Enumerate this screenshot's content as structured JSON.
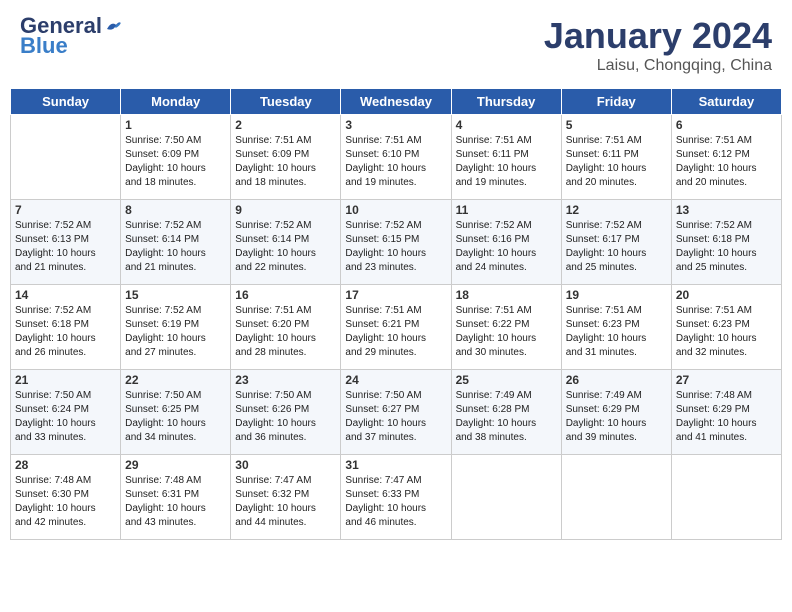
{
  "header": {
    "logo_general": "General",
    "logo_blue": "Blue",
    "month": "January 2024",
    "location": "Laisu, Chongqing, China"
  },
  "weekdays": [
    "Sunday",
    "Monday",
    "Tuesday",
    "Wednesday",
    "Thursday",
    "Friday",
    "Saturday"
  ],
  "weeks": [
    [
      {
        "day": "",
        "info": ""
      },
      {
        "day": "1",
        "info": "Sunrise: 7:50 AM\nSunset: 6:09 PM\nDaylight: 10 hours\nand 18 minutes."
      },
      {
        "day": "2",
        "info": "Sunrise: 7:51 AM\nSunset: 6:09 PM\nDaylight: 10 hours\nand 18 minutes."
      },
      {
        "day": "3",
        "info": "Sunrise: 7:51 AM\nSunset: 6:10 PM\nDaylight: 10 hours\nand 19 minutes."
      },
      {
        "day": "4",
        "info": "Sunrise: 7:51 AM\nSunset: 6:11 PM\nDaylight: 10 hours\nand 19 minutes."
      },
      {
        "day": "5",
        "info": "Sunrise: 7:51 AM\nSunset: 6:11 PM\nDaylight: 10 hours\nand 20 minutes."
      },
      {
        "day": "6",
        "info": "Sunrise: 7:51 AM\nSunset: 6:12 PM\nDaylight: 10 hours\nand 20 minutes."
      }
    ],
    [
      {
        "day": "7",
        "info": "Sunrise: 7:52 AM\nSunset: 6:13 PM\nDaylight: 10 hours\nand 21 minutes."
      },
      {
        "day": "8",
        "info": "Sunrise: 7:52 AM\nSunset: 6:14 PM\nDaylight: 10 hours\nand 21 minutes."
      },
      {
        "day": "9",
        "info": "Sunrise: 7:52 AM\nSunset: 6:14 PM\nDaylight: 10 hours\nand 22 minutes."
      },
      {
        "day": "10",
        "info": "Sunrise: 7:52 AM\nSunset: 6:15 PM\nDaylight: 10 hours\nand 23 minutes."
      },
      {
        "day": "11",
        "info": "Sunrise: 7:52 AM\nSunset: 6:16 PM\nDaylight: 10 hours\nand 24 minutes."
      },
      {
        "day": "12",
        "info": "Sunrise: 7:52 AM\nSunset: 6:17 PM\nDaylight: 10 hours\nand 25 minutes."
      },
      {
        "day": "13",
        "info": "Sunrise: 7:52 AM\nSunset: 6:18 PM\nDaylight: 10 hours\nand 25 minutes."
      }
    ],
    [
      {
        "day": "14",
        "info": "Sunrise: 7:52 AM\nSunset: 6:18 PM\nDaylight: 10 hours\nand 26 minutes."
      },
      {
        "day": "15",
        "info": "Sunrise: 7:52 AM\nSunset: 6:19 PM\nDaylight: 10 hours\nand 27 minutes."
      },
      {
        "day": "16",
        "info": "Sunrise: 7:51 AM\nSunset: 6:20 PM\nDaylight: 10 hours\nand 28 minutes."
      },
      {
        "day": "17",
        "info": "Sunrise: 7:51 AM\nSunset: 6:21 PM\nDaylight: 10 hours\nand 29 minutes."
      },
      {
        "day": "18",
        "info": "Sunrise: 7:51 AM\nSunset: 6:22 PM\nDaylight: 10 hours\nand 30 minutes."
      },
      {
        "day": "19",
        "info": "Sunrise: 7:51 AM\nSunset: 6:23 PM\nDaylight: 10 hours\nand 31 minutes."
      },
      {
        "day": "20",
        "info": "Sunrise: 7:51 AM\nSunset: 6:23 PM\nDaylight: 10 hours\nand 32 minutes."
      }
    ],
    [
      {
        "day": "21",
        "info": "Sunrise: 7:50 AM\nSunset: 6:24 PM\nDaylight: 10 hours\nand 33 minutes."
      },
      {
        "day": "22",
        "info": "Sunrise: 7:50 AM\nSunset: 6:25 PM\nDaylight: 10 hours\nand 34 minutes."
      },
      {
        "day": "23",
        "info": "Sunrise: 7:50 AM\nSunset: 6:26 PM\nDaylight: 10 hours\nand 36 minutes."
      },
      {
        "day": "24",
        "info": "Sunrise: 7:50 AM\nSunset: 6:27 PM\nDaylight: 10 hours\nand 37 minutes."
      },
      {
        "day": "25",
        "info": "Sunrise: 7:49 AM\nSunset: 6:28 PM\nDaylight: 10 hours\nand 38 minutes."
      },
      {
        "day": "26",
        "info": "Sunrise: 7:49 AM\nSunset: 6:29 PM\nDaylight: 10 hours\nand 39 minutes."
      },
      {
        "day": "27",
        "info": "Sunrise: 7:48 AM\nSunset: 6:29 PM\nDaylight: 10 hours\nand 41 minutes."
      }
    ],
    [
      {
        "day": "28",
        "info": "Sunrise: 7:48 AM\nSunset: 6:30 PM\nDaylight: 10 hours\nand 42 minutes."
      },
      {
        "day": "29",
        "info": "Sunrise: 7:48 AM\nSunset: 6:31 PM\nDaylight: 10 hours\nand 43 minutes."
      },
      {
        "day": "30",
        "info": "Sunrise: 7:47 AM\nSunset: 6:32 PM\nDaylight: 10 hours\nand 44 minutes."
      },
      {
        "day": "31",
        "info": "Sunrise: 7:47 AM\nSunset: 6:33 PM\nDaylight: 10 hours\nand 46 minutes."
      },
      {
        "day": "",
        "info": ""
      },
      {
        "day": "",
        "info": ""
      },
      {
        "day": "",
        "info": ""
      }
    ]
  ]
}
